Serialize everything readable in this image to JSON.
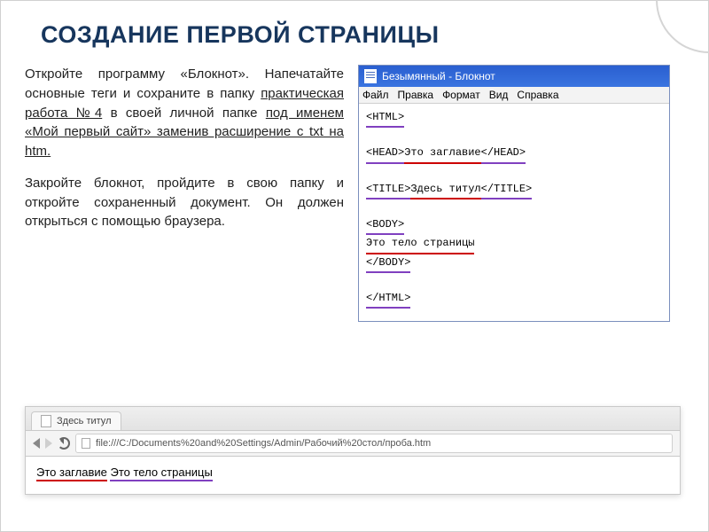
{
  "title": "СОЗДАНИЕ ПЕРВОЙ СТРАНИЦЫ",
  "paragraph1": {
    "t1": "Откройте программу «Блокнот». Напечатайте основные теги и сохраните в папку ",
    "u1": "практическая работа №4",
    "t2": " в своей личной папке ",
    "u2": "под именем «Мой первый сайт» заменив расширение с txt на  htm.",
    "t3": ""
  },
  "paragraph2": "Закройте блокнот, пройдите в свою папку и откройте сохраненный документ. Он должен открыться с помощью браузера.",
  "notepad": {
    "title": "Безымянный - Блокнот",
    "menu": [
      "Файл",
      "Правка",
      "Формат",
      "Вид",
      "Справка"
    ],
    "lines": [
      {
        "a": "<HTML>",
        "ac": "sq-pur"
      },
      {
        "a": ""
      },
      {
        "a": "<HEAD>",
        "ac": "sq-pur",
        "b": "Это заглавие",
        "bc": "sq-red",
        "c": "</HEAD>",
        "cc": "sq-pur"
      },
      {
        "a": ""
      },
      {
        "a": "<TITLE>",
        "ac": "sq-pur",
        "b": "Здесь титул",
        "bc": "sq-red",
        "c": "</TITLE>",
        "cc": "sq-pur"
      },
      {
        "a": ""
      },
      {
        "a": "<BODY>",
        "ac": "sq-pur"
      },
      {
        "a": "Это тело страницы",
        "ac": "sq-red"
      },
      {
        "a": "</BODY>",
        "ac": "sq-pur"
      },
      {
        "a": ""
      },
      {
        "a": "</HTML>",
        "ac": "sq-pur"
      }
    ]
  },
  "browser": {
    "tab": "Здесь титул",
    "url": "file:///C:/Documents%20and%20Settings/Admin/Рабочий%20стол/проба.htm",
    "content": [
      {
        "t": "Это заглавие",
        "c": "sq-red"
      },
      {
        "t": " "
      },
      {
        "t": "Это тело страницы",
        "c": "sq-pur"
      }
    ]
  }
}
